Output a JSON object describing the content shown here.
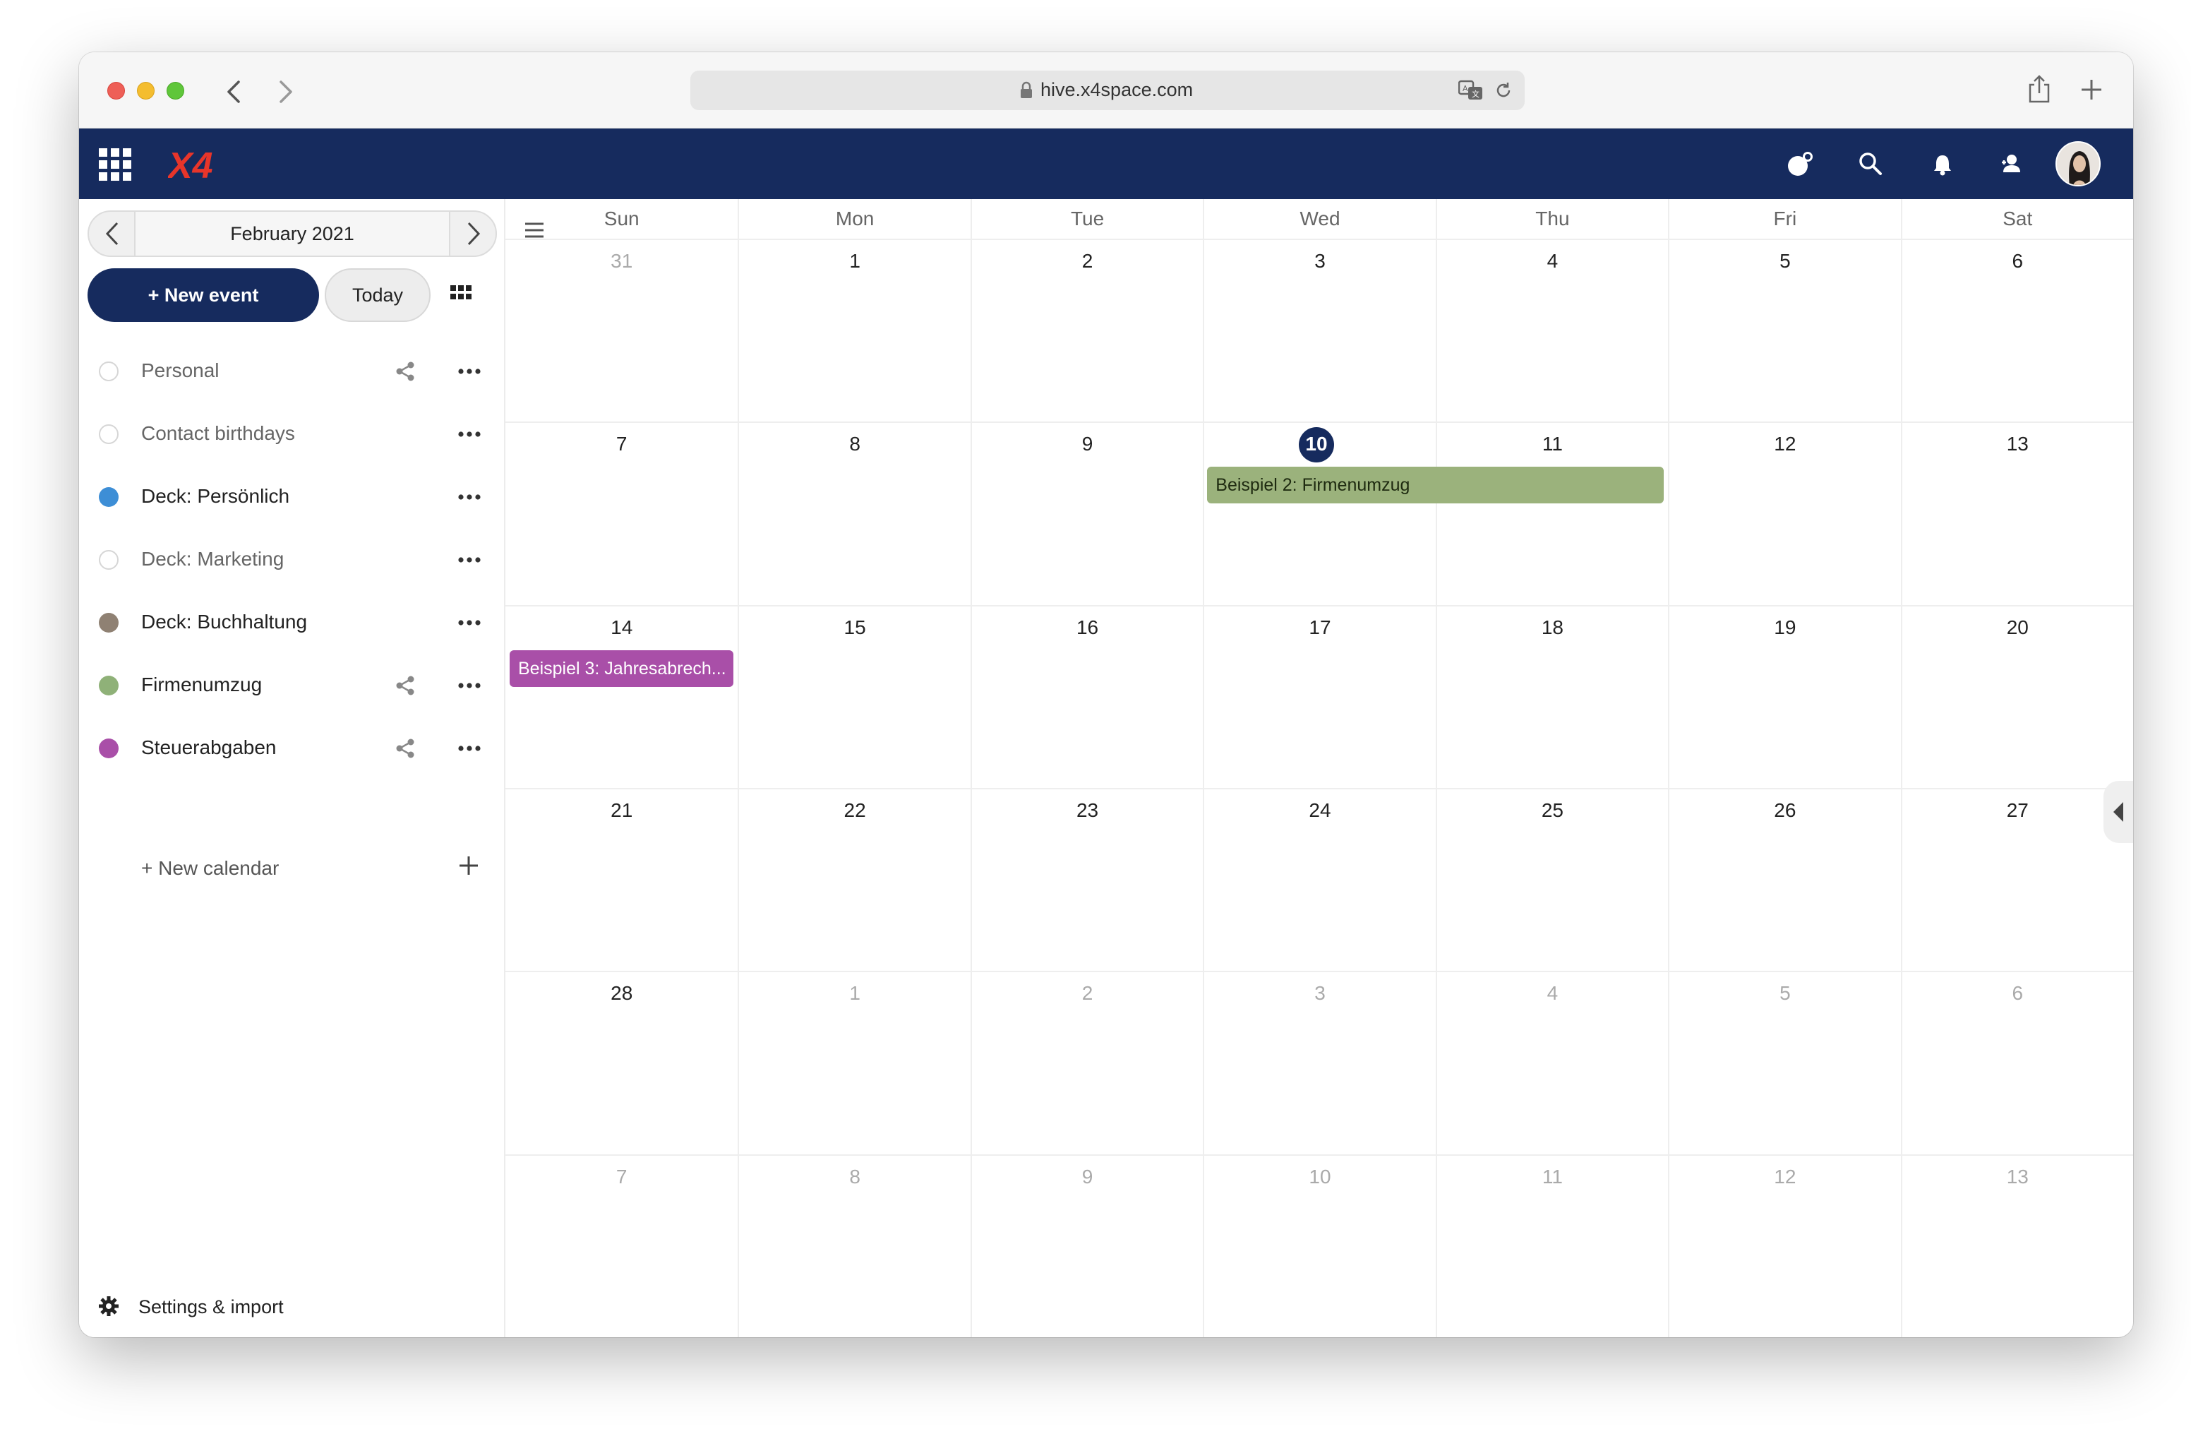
{
  "browser": {
    "url": "hive.x4space.com",
    "icons": [
      "lock-icon",
      "translate-icon",
      "reload-icon",
      "share-icon",
      "new-tab-icon",
      "back-icon",
      "forward-icon"
    ]
  },
  "app": {
    "logo_text": "X4",
    "colors": {
      "header": "#162b5e",
      "accent": "#162b5e",
      "logo": "#e8352a"
    },
    "header_icons": [
      "apps-grid-icon",
      "dashboard-icon",
      "search-icon",
      "bell-icon",
      "contacts-icon",
      "avatar"
    ]
  },
  "sidebar": {
    "month_label": "February 2021",
    "new_event_label": "+ New event",
    "today_label": "Today",
    "calendars": [
      {
        "name": "Personal",
        "color": "",
        "enabled": false,
        "shared": true
      },
      {
        "name": "Contact birthdays",
        "color": "",
        "enabled": false,
        "shared": false
      },
      {
        "name": "Deck: Persönlich",
        "color": "#3d8ed6",
        "enabled": true,
        "shared": false
      },
      {
        "name": "Deck: Marketing",
        "color": "",
        "enabled": false,
        "shared": false
      },
      {
        "name": "Deck: Buchhaltung",
        "color": "#8f8173",
        "enabled": true,
        "shared": false
      },
      {
        "name": "Firmenumzug",
        "color": "#8fb178",
        "enabled": true,
        "shared": true
      },
      {
        "name": "Steuerabgaben",
        "color": "#a94fa8",
        "enabled": true,
        "shared": true
      }
    ],
    "new_calendar_label": "+ New calendar",
    "settings_label": "Settings & import"
  },
  "calendar": {
    "weekdays": [
      "Sun",
      "Mon",
      "Tue",
      "Wed",
      "Thu",
      "Fri",
      "Sat"
    ],
    "weeks": [
      [
        [
          "31",
          true
        ],
        [
          "1",
          false
        ],
        [
          "2",
          false
        ],
        [
          "3",
          false
        ],
        [
          "4",
          false
        ],
        [
          "5",
          false
        ],
        [
          "6",
          false
        ]
      ],
      [
        [
          "7",
          false
        ],
        [
          "8",
          false
        ],
        [
          "9",
          false
        ],
        [
          "10",
          false
        ],
        [
          "11",
          false
        ],
        [
          "12",
          false
        ],
        [
          "13",
          false
        ]
      ],
      [
        [
          "14",
          false
        ],
        [
          "15",
          false
        ],
        [
          "16",
          false
        ],
        [
          "17",
          false
        ],
        [
          "18",
          false
        ],
        [
          "19",
          false
        ],
        [
          "20",
          false
        ]
      ],
      [
        [
          "21",
          false
        ],
        [
          "22",
          false
        ],
        [
          "23",
          false
        ],
        [
          "24",
          false
        ],
        [
          "25",
          false
        ],
        [
          "26",
          false
        ],
        [
          "27",
          false
        ]
      ],
      [
        [
          "28",
          false
        ],
        [
          "1",
          true
        ],
        [
          "2",
          true
        ],
        [
          "3",
          true
        ],
        [
          "4",
          true
        ],
        [
          "5",
          true
        ],
        [
          "6",
          true
        ]
      ],
      [
        [
          "7",
          true
        ],
        [
          "8",
          true
        ],
        [
          "9",
          true
        ],
        [
          "10",
          true
        ],
        [
          "11",
          true
        ],
        [
          "12",
          true
        ],
        [
          "13",
          true
        ]
      ]
    ],
    "today_date": "10",
    "events": [
      {
        "title": "Beispiel 2: Firmenumzug",
        "color": "#9bb27c"
      },
      {
        "title": "Beispiel 3: Jahresabrech...",
        "color": "#a94fa8"
      }
    ]
  }
}
